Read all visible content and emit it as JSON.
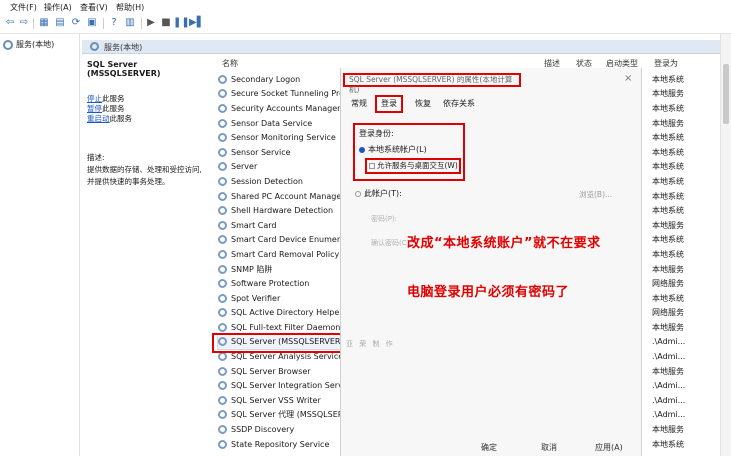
{
  "menu": [
    "文件(F)",
    "操作(A)",
    "查看(V)",
    "帮助(H)"
  ],
  "tree": {
    "label": "服务(本地)"
  },
  "header": {
    "title": "服务(本地)"
  },
  "details": {
    "title": "SQL Server (MSSQLSERVER)",
    "links": [
      {
        "link": "停止",
        "rest": "此服务"
      },
      {
        "link": "暂停",
        "rest": "此服务"
      },
      {
        "link": "重启动",
        "rest": "此服务"
      }
    ],
    "desc_label": "描述:",
    "desc_text": [
      "提供数据的存储、处理和受控访问,",
      "并提供快速的事务处理。"
    ]
  },
  "columns": {
    "name": "名称",
    "desc": "描述",
    "status": "状态",
    "startup": "启动类型",
    "logon": "登录为"
  },
  "services": [
    "Secondary Logon",
    "Secure Socket Tunneling Protoc",
    "Security Accounts Manager",
    "Sensor Data Service",
    "Sensor Monitoring Service",
    "Sensor Service",
    "Server",
    "Session Detection",
    "Shared PC Account Manager",
    "Shell Hardware Detection",
    "Smart Card",
    "Smart Card Device Enumeration",
    "Smart Card Removal Policy",
    "SNMP 陷阱",
    "Software Protection",
    "Spot Verifier",
    "SQL Active Directory Helper 服务",
    "SQL Full-text Filter Daemon Lau",
    "SQL Server (MSSQLSERVER)",
    "SQL Server Analysis Services (M",
    "SQL Server Browser",
    "SQL Server Integration Services",
    "SQL Server VSS Writer",
    "SQL Server 代理 (MSSQLSERVE",
    "SSDP Discovery",
    "State Repository Service"
  ],
  "logon_as": [
    "本地系统",
    "本地服务",
    "本地系统",
    "本地服务",
    "本地系统",
    "本地系统",
    "本地系统",
    "本地系统",
    "本地系统",
    "本地系统",
    "本地服务",
    "本地系统",
    "本地系统",
    "本地服务",
    "网络服务",
    "本地系统",
    "网络服务",
    "本地服务",
    ".\\Admi...",
    ".\\Admi...",
    "本地服务",
    ".\\Admi...",
    ".\\Admi...",
    ".\\Admi...",
    "本地服务",
    "本地系统"
  ],
  "dialog": {
    "title": "SQL Server (MSSQLSERVER) 的属性(本地计算机)",
    "close": "×",
    "tabs": [
      "常规",
      "登录",
      "恢复",
      "依存关系"
    ],
    "logon_label": "登录身份:",
    "local_system": "本地系统帐户(L)",
    "interact": "允许服务与桌面交互(W)",
    "this_account": "此帐户(T):",
    "browse": "浏览(B)...",
    "password": "密码(P):",
    "confirm": "确认密码(C):",
    "ok": "确定",
    "cancel": "取消",
    "apply": "应用(A)"
  },
  "annotations": {
    "line1": "改成“本地系统账户”就不在要求",
    "line2": "电脑登录用户必须有密码了"
  },
  "watermark": "亚 荣 制 作"
}
